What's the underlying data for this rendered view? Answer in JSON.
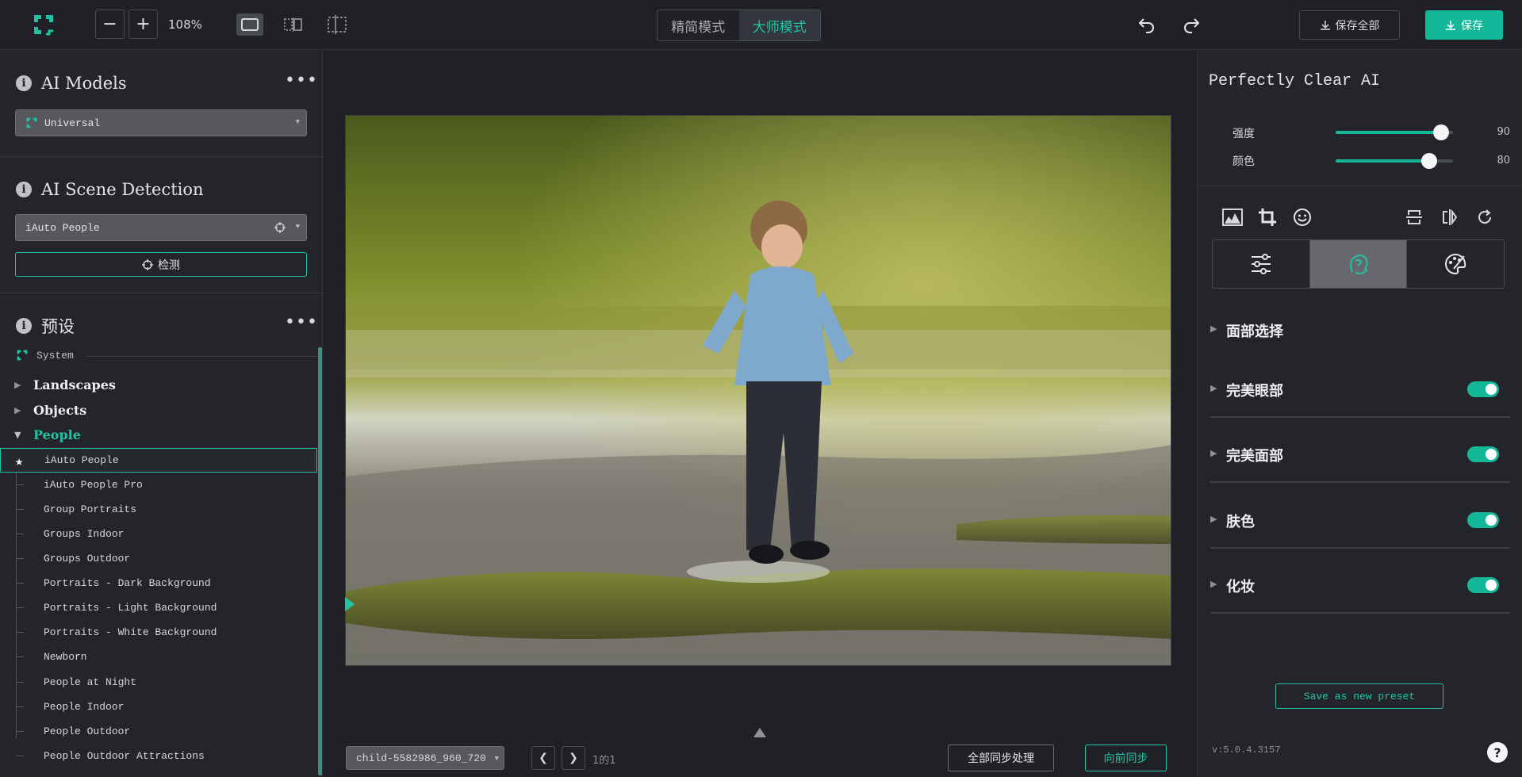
{
  "toolbar": {
    "zoom_out": "−",
    "zoom_in": "+",
    "zoom_level": "108%",
    "mode_simple": "精简模式",
    "mode_master": "大师模式",
    "save_all": "保存全部",
    "save": "保存"
  },
  "left": {
    "ai_models_title": "AI Models",
    "model_value": "Universal",
    "scene_title": "AI Scene Detection",
    "scene_value": "iAuto People",
    "detect_label": "检测",
    "presets_title": "预设",
    "system_label": "System",
    "categories": [
      "Landscapes",
      "Objects",
      "People"
    ],
    "people_items": [
      "iAuto People",
      "iAuto People Pro",
      "Group Portraits",
      "Groups Indoor",
      "Groups Outdoor",
      "Portraits - Dark Background",
      "Portraits - Light Background",
      "Portraits - White Background",
      "Newborn",
      "People at Night",
      "People Indoor",
      "People Outdoor",
      "People Outdoor Attractions"
    ]
  },
  "center": {
    "file_name": "child-5582986_960_720",
    "page_info": "1的1",
    "sync_all": "全部同步处理",
    "sync_forward": "向前同步"
  },
  "right": {
    "title": "Perfectly Clear AI",
    "sliders": [
      {
        "label": "强度",
        "value": 90
      },
      {
        "label": "颜色",
        "value": 80
      }
    ],
    "sections": [
      {
        "label": "面部选择",
        "toggle": false
      },
      {
        "label": "完美眼部",
        "toggle": true
      },
      {
        "label": "完美面部",
        "toggle": true
      },
      {
        "label": "肤色",
        "toggle": true
      },
      {
        "label": "化妆",
        "toggle": true
      }
    ],
    "save_preset": "Save as new preset",
    "version": "v:5.0.4.3157",
    "help": "?"
  },
  "colors": {
    "accent": "#14b898",
    "bg": "#202127",
    "panel": "#24252b"
  }
}
